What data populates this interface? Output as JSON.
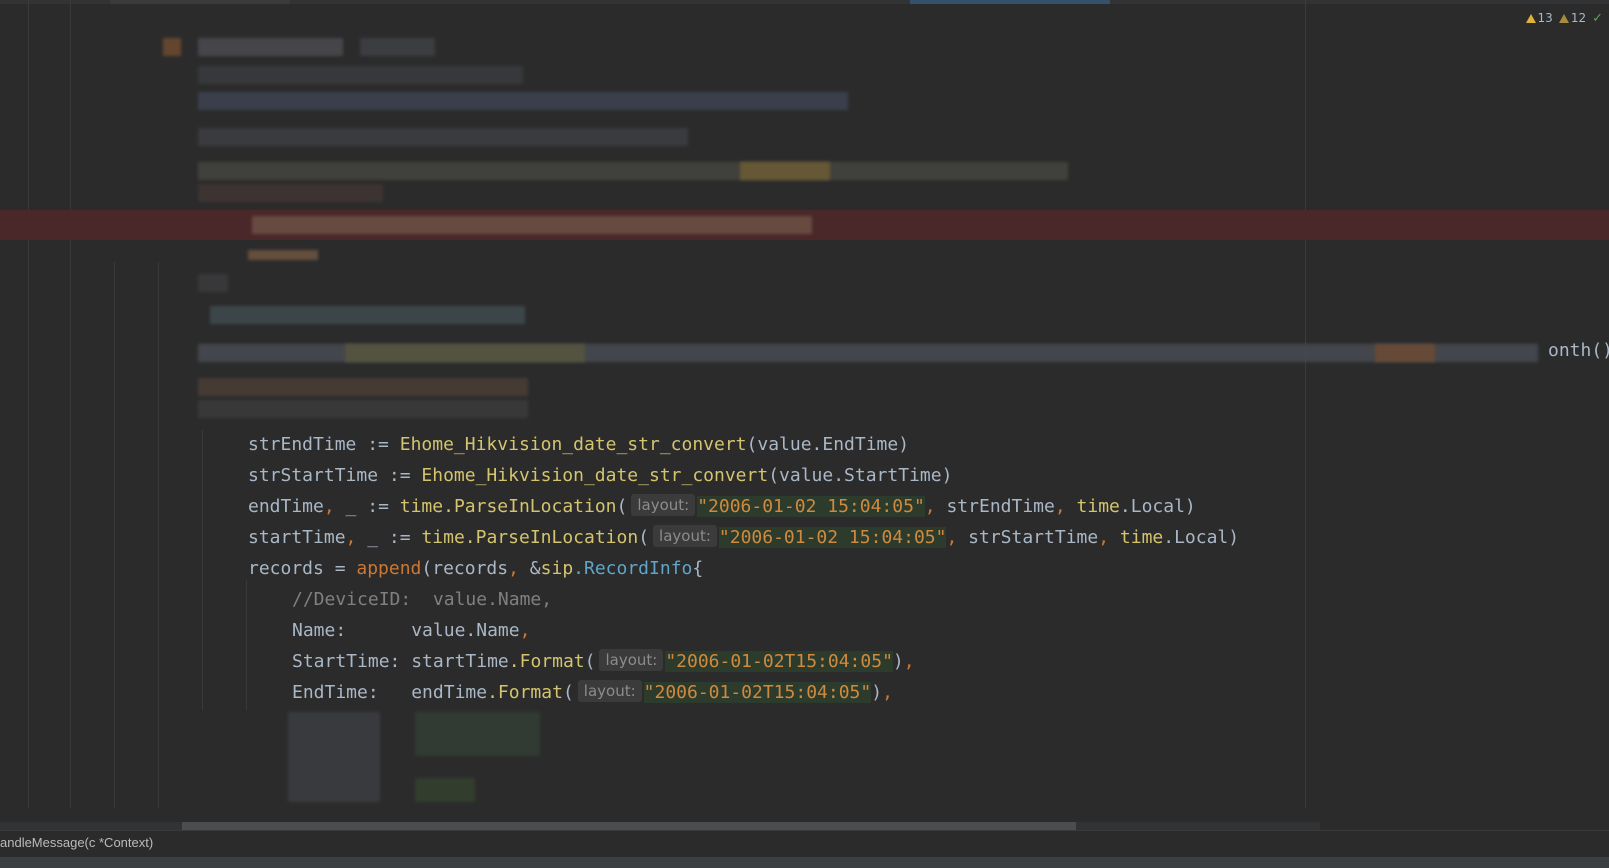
{
  "inspections": {
    "warnings": "13",
    "weak_warnings": "12"
  },
  "cut_text": "onth()",
  "code": {
    "l1": {
      "var": "strEndTime",
      "op": " := ",
      "fn": "Ehome_Hikvision_date_str_convert",
      "args": "(value.EndTime)"
    },
    "l2": {
      "var": "strStartTime",
      "op": " := ",
      "fn": "Ehome_Hikvision_date_str_convert",
      "args": "(value.StartTime)"
    },
    "l3": {
      "var": "endTime",
      "sep": ", ",
      "blank": "_",
      "op": " := ",
      "pkg": "time",
      "fn": ".ParseInLocation",
      "open": "(",
      "hint": "layout:",
      "str": "\"2006-01-02 15:04:05\"",
      "arg2": "strEndTime",
      "pkg2": "time",
      "tail": ".Local)"
    },
    "l4": {
      "var": "startTime",
      "sep": ", ",
      "blank": "_",
      "op": " := ",
      "pkg": "time",
      "fn": ".ParseInLocation",
      "open": "(",
      "hint": "layout:",
      "str": "\"2006-01-02 15:04:05\"",
      "arg2": "strStartTime",
      "pkg2": "time",
      "tail": ".Local)"
    },
    "l5": {
      "var": "records",
      "op": " = ",
      "fn": "append",
      "args": "(records",
      "sep": ", ",
      "amp": "&",
      "pkg": "sip",
      "type": ".RecordInfo",
      "brace": "{"
    },
    "l6": {
      "comment": "//DeviceID:  value.Name,"
    },
    "l7": {
      "key": "Name:",
      "pad": "      ",
      "val": "value.Name",
      "comma": ","
    },
    "l8": {
      "key": "StartTime:",
      "pad": " ",
      "obj": "startTime",
      "fn": ".Format",
      "open": "(",
      "hint": "layout:",
      "str": "\"2006-01-02T15:04:05\"",
      "close": ")",
      "comma": ","
    },
    "l9": {
      "key": "EndTime:",
      "pad": "   ",
      "obj": "endTime",
      "fn": ".Format",
      "open": "(",
      "hint": "layout:",
      "str": "\"2006-01-02T15:04:05\"",
      "close": ")",
      "comma": ","
    }
  },
  "breadcrumb": "andleMessage(c *Context)",
  "colors": {
    "background": "#2b2b2b",
    "identifier": "#a9b7c6",
    "function": "#d4c46d",
    "keyword": "#cc7832",
    "string": "#d08a3e",
    "type": "#5fa6c9",
    "comment": "#808080",
    "error_line": "#4a2729"
  },
  "icons": [
    "warning-icon",
    "weak-warning-icon",
    "check-icon"
  ]
}
